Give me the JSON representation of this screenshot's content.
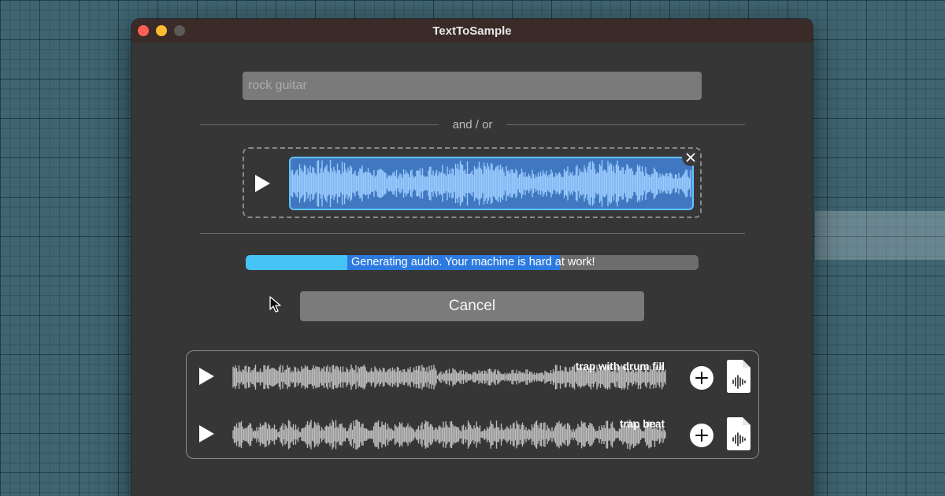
{
  "window": {
    "title": "TextToSample"
  },
  "prompt": {
    "value": "",
    "placeholder": "rock guitar"
  },
  "separator": {
    "label": "and / or"
  },
  "progress": {
    "label": "Generating audio. Your machine is hard at work!",
    "fraction": 0.23
  },
  "cancel": {
    "label": "Cancel"
  },
  "samples": [
    {
      "name": "trap with drum fill"
    },
    {
      "name": "trap beat"
    }
  ],
  "icons": {
    "close_window": "close-dot",
    "minimize_window": "minimize-dot",
    "maximize_window": "maximize-dot",
    "play": "play-icon",
    "remove": "close-icon",
    "add": "plus-circle-icon",
    "export": "audio-file-icon",
    "cursor": "mouse-pointer-icon"
  },
  "colors": {
    "accent_blue": "#2c7ae0",
    "progress_cyan": "#45c3f5",
    "waveform_selected": "#9ccbff",
    "waveform": "#bdbdbd"
  }
}
